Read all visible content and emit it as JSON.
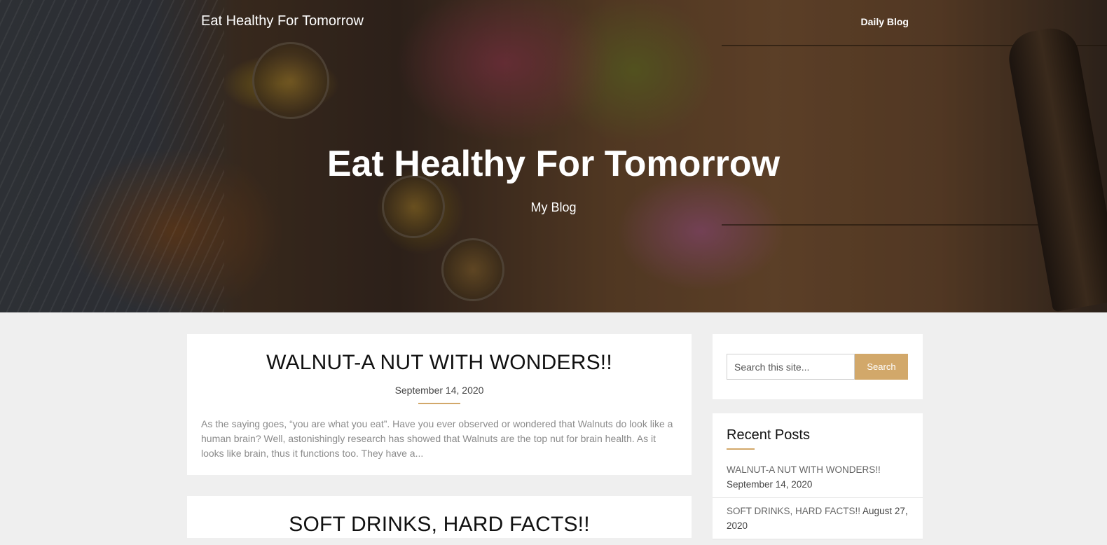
{
  "header": {
    "site_name": "Eat Healthy For Tomorrow",
    "nav_link": "Daily Blog"
  },
  "hero": {
    "title": "Eat Healthy For Tomorrow",
    "subtitle": "My Blog"
  },
  "posts": [
    {
      "title": "WALNUT-A NUT WITH WONDERS!!",
      "date": "September 14, 2020",
      "excerpt": "As the saying goes, “you are what you eat”. Have you ever observed or wondered that Walnuts do look like a human brain? Well, astonishingly research has showed that Walnuts are the top nut for brain health. As it looks like brain, thus it functions too. They have a..."
    },
    {
      "title": "SOFT DRINKS, HARD FACTS!!"
    }
  ],
  "search": {
    "placeholder": "Search this site...",
    "button_label": "Search"
  },
  "recent_posts": {
    "title": "Recent Posts",
    "items": [
      {
        "title": "WALNUT-A NUT WITH WONDERS!!",
        "date": "September 14, 2020"
      },
      {
        "title": "SOFT DRINKS, HARD FACTS!!",
        "date": "August 27, 2020"
      }
    ]
  },
  "colors": {
    "accent": "#d2a86a",
    "background": "#efefef"
  }
}
